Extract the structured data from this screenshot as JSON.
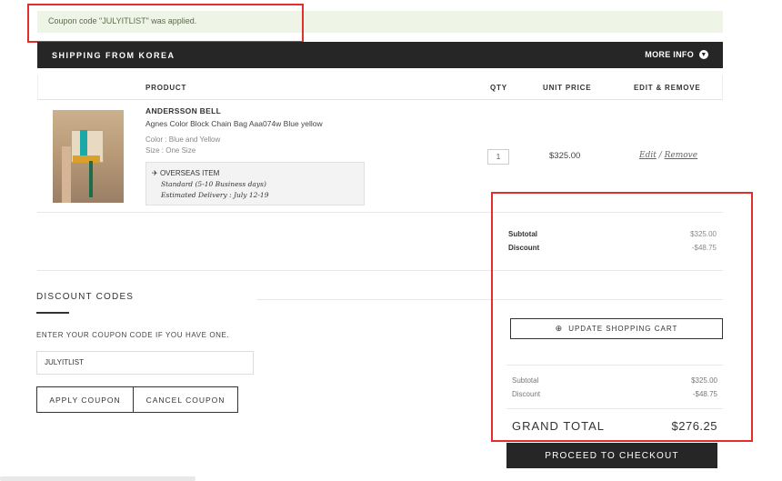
{
  "notice": {
    "text": "Coupon code \"JULYITLIST\" was applied."
  },
  "shipping": {
    "title": "SHIPPING FROM KOREA",
    "more_info": "MORE INFO"
  },
  "table": {
    "headers": {
      "product": "PRODUCT",
      "qty": "QTY",
      "unit_price": "UNIT PRICE",
      "edit_remove": "EDIT & REMOVE"
    }
  },
  "item": {
    "brand": "ANDERSSON BELL",
    "name": "Agnes Color Block Chain Bag Aaa074w Blue yellow",
    "color": "Color : Blue and Yellow",
    "size": "Size : One Size",
    "overseas_label": "OVERSEAS ITEM",
    "shipping_method": "Standard (5-10 Business days)",
    "estimated_delivery": "Estimated Delivery : July 12-19",
    "qty": "1",
    "unit_price": "$325.00",
    "edit": "Edit",
    "separator": "/",
    "remove": "Remove"
  },
  "summary_top": {
    "subtotal_label": "Subtotal",
    "subtotal": "$325.00",
    "discount_label": "Discount",
    "discount": "-$48.75"
  },
  "discount_codes": {
    "title": "DISCOUNT CODES",
    "hint": "ENTER YOUR COUPON CODE IF YOU HAVE ONE.",
    "value": "JULYITLIST",
    "apply": "APPLY COUPON",
    "cancel": "CANCEL COUPON"
  },
  "update_cart": "UPDATE SHOPPING CART",
  "summary_bottom": {
    "subtotal_label": "Subtotal",
    "subtotal": "$325.00",
    "discount_label": "Discount",
    "discount": "-$48.75"
  },
  "grand_total": {
    "label": "GRAND TOTAL",
    "value": "$276.25"
  },
  "checkout": "PROCEED TO CHECKOUT",
  "colors": {
    "dark": "#262626",
    "notice_bg": "#eef4e6",
    "highlight": "#e0302e"
  }
}
